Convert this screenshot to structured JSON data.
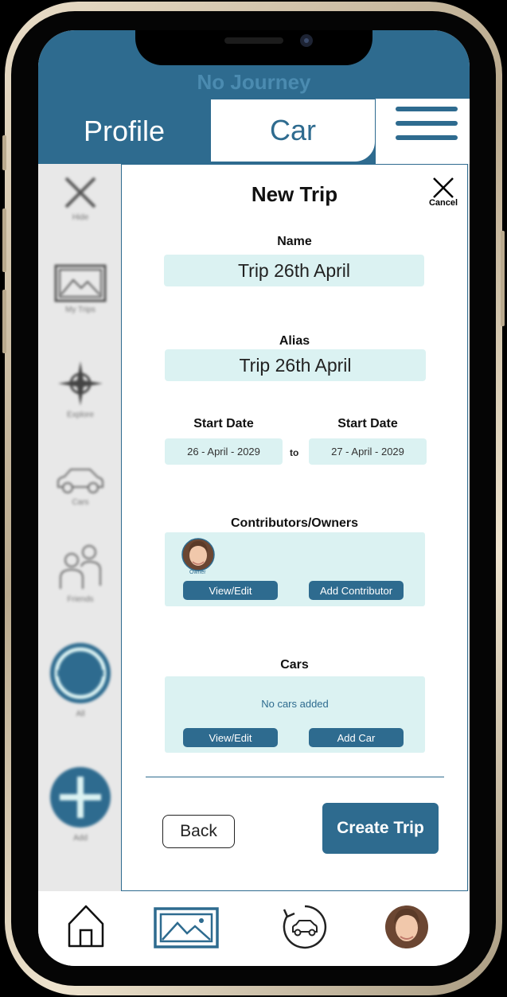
{
  "header": {
    "journey_status": "No Journey",
    "tabs": [
      {
        "label": "Profile",
        "active": false
      },
      {
        "label": "Car",
        "active": true
      }
    ],
    "menu_icon": "hamburger-menu-icon"
  },
  "sidebar": {
    "items": [
      {
        "icon": "close-x-icon",
        "label": "Hide"
      },
      {
        "icon": "image-icon",
        "label": "My Trips"
      },
      {
        "icon": "compass-icon",
        "label": "Explore"
      },
      {
        "icon": "car-icon",
        "label": "Cars"
      },
      {
        "icon": "people-icon",
        "label": "Friends"
      },
      {
        "icon": "link-icon",
        "label": "All"
      },
      {
        "icon": "plus-icon",
        "label": "Add"
      }
    ]
  },
  "modal": {
    "title": "New Trip",
    "cancel_label": "Cancel",
    "name": {
      "label": "Name",
      "value": "Trip 26th April"
    },
    "alias": {
      "label": "Alias",
      "value": "Trip 26th April"
    },
    "start_date": {
      "label": "Start Date",
      "value": "26 - April - 2029"
    },
    "end_date": {
      "label": "Start Date",
      "value": "27 - April - 2029"
    },
    "date_separator": "to",
    "contributors": {
      "label": "Contributors/Owners",
      "owner_role": "Owner",
      "view_edit_label": "View/Edit",
      "add_label": "Add Contributor"
    },
    "cars": {
      "label": "Cars",
      "empty_text": "No cars added",
      "view_edit_label": "View/Edit",
      "add_label": "Add Car"
    },
    "back_label": "Back",
    "create_label": "Create Trip"
  },
  "bottom_nav": {
    "items": [
      {
        "icon": "home-icon"
      },
      {
        "icon": "gallery-icon",
        "active": true
      },
      {
        "icon": "car-history-icon"
      },
      {
        "icon": "profile-avatar"
      }
    ]
  },
  "colors": {
    "primary": "#2e6b8f",
    "field_bg": "#dbf2f2",
    "journey_text": "#4b8bb0"
  }
}
